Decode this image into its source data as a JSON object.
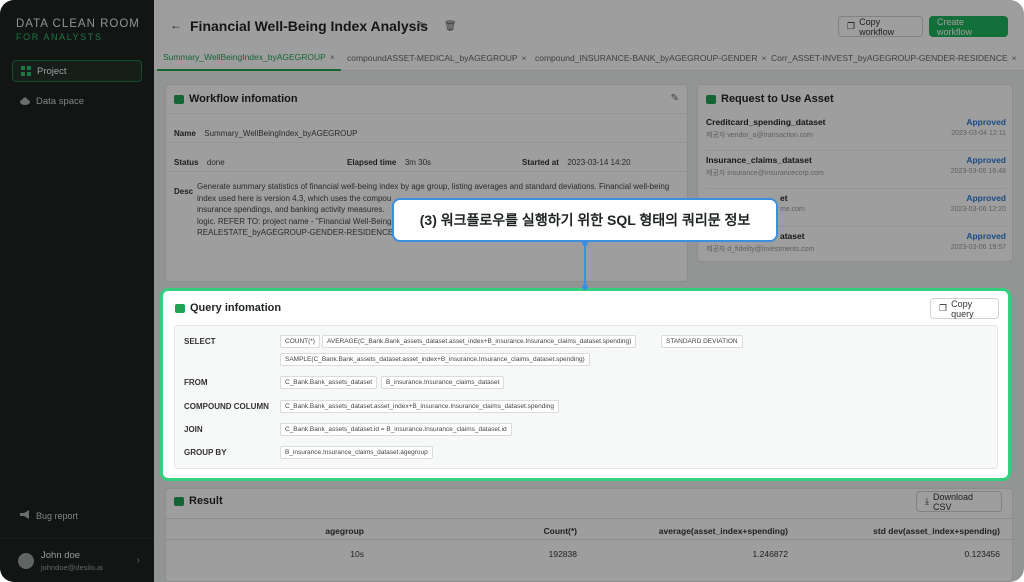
{
  "brand": {
    "title": "DATA CLEAN ROOM",
    "subtitle": "FOR ANALYSTS"
  },
  "sidebar": {
    "items": [
      {
        "label": "Project",
        "icon": "grid-icon",
        "active": true
      },
      {
        "label": "Data space",
        "icon": "cloud-icon",
        "active": false
      }
    ],
    "bug_report": "Bug report",
    "user": {
      "name": "John doe",
      "email": "johndoe@desilo.ai"
    }
  },
  "header": {
    "title": "Financial Well-Being Index Analysis",
    "copy_workflow": "Copy workflow",
    "create_workflow": "Create workflow"
  },
  "tabs": [
    {
      "label": "Summary_WellBeingIndex_byAGEGROUP",
      "active": true
    },
    {
      "label": "compoundASSET-MEDICAL_byAGEGROUP",
      "active": false
    },
    {
      "label": "compound_INSURANCE-BANK_byAGEGROUP-GENDER",
      "active": false
    },
    {
      "label": "Corr_ASSET-INVEST_byAGEGROUP-GENDER-RESIDENCE",
      "active": false
    }
  ],
  "workflow": {
    "title": "Workflow infomation",
    "name_label": "Name",
    "name": "Summary_WellBeingIndex_byAGEGROUP",
    "status_label": "Status",
    "status": "done",
    "elapsed_label": "Elapsed time",
    "elapsed": "3m 30s",
    "started_label": "Started at",
    "started": "2023-03-14 14:20",
    "desc_label": "Desc",
    "desc_lines": [
      "Generate summary statistics of financial well-being index by age group, listing averages and standard deviations. Financial well-being",
      "index used here is version 4.3, which uses the compou",
      "insurance spendings, and banking activity measures.",
      "logic. REFER TO: project name - \"Financial Well-Being",
      "REALESTATE_byAGEGROUP-GENDER-RESIDENCE\")"
    ]
  },
  "requests": {
    "title": "Request to Use Asset",
    "items": [
      {
        "name": "Creditcard_spending_dataset",
        "sub": "제공자  vendor_a@transaction.com",
        "status": "Approved",
        "date": "2023-03-04 12:11"
      },
      {
        "name": "Insurance_claims_dataset",
        "sub": "제공자  insurance@insurancecorp.com",
        "status": "Approved",
        "date": "2023-03-05 16:48"
      },
      {
        "name": "et",
        "sub": "me.com",
        "status": "Approved",
        "date": "2023-03-06 12:20"
      },
      {
        "name": "ataset",
        "sub": "제공자  d_fidelity@investments.com",
        "status": "Approved",
        "date": "2023-03-06 19:57"
      }
    ]
  },
  "query": {
    "title": "Query infomation",
    "copy": "Copy query",
    "select_label": "SELECT",
    "select_chips": [
      "COUNT(*)",
      "AVERAGE(C_Bank.Bank_assets_dataset.asset_index+B_insurance.Insurance_claims_dataset.spending)",
      "STANDARD DEVIATION",
      "SAMPLE(C_Bank.Bank_assets_dataset.asset_index+B_insurance.Insurance_claims_dataset.spending)"
    ],
    "from_label": "FROM",
    "from_chips": [
      "C_Bank.Bank_assets_dataset",
      "B_insurance.Insurance_claims_dataset"
    ],
    "compound_label": "COMPOUND COLUMN",
    "compound_chip": "C_Bank.Bank_assets_dataset.asset_index+B_insurance.Insurance_claims_dataset.spending",
    "join_label": "JOIN",
    "join_chip": "C_Bank.Bank_assets_dataset.id = B_insurance.Insurance_claims_dataset.id",
    "group_label": "GROUP BY",
    "group_chip": "B_insurance.Insurance_claims_dataset.agegroup"
  },
  "result": {
    "title": "Result",
    "download": "Download CSV",
    "columns": [
      "agegroup",
      "Count(*)",
      "average(asset_index+spending)",
      "std dev(asset_index+spending)"
    ],
    "row": [
      "10s",
      "192838",
      "1.246872",
      "0.123456"
    ]
  },
  "callout": "(3) 워크플로우를 실행하기 위한 SQL 형태의 쿼리문 정보",
  "colors": {
    "accent": "#1fb35c",
    "highlight": "#35d07f",
    "callout_border": "#3c8fe0",
    "approved": "#2a7bd4"
  }
}
